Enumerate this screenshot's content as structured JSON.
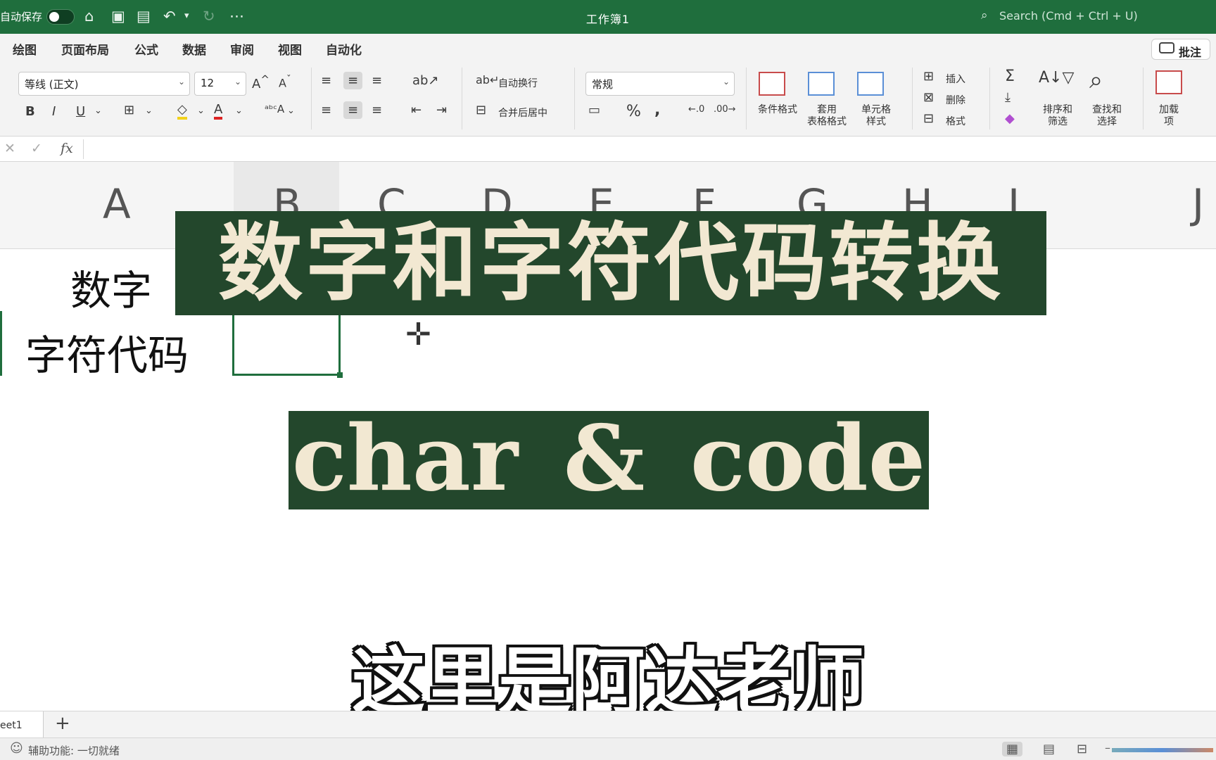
{
  "titlebar": {
    "autosave_label": "自动保存",
    "document_title": "工作簿1",
    "search_placeholder": "Search (Cmd + Ctrl + U)"
  },
  "menu_tabs": [
    "绘图",
    "页面布局",
    "公式",
    "数据",
    "审阅",
    "视图",
    "自动化"
  ],
  "comment_button": "批注",
  "ribbon": {
    "font_name": "等线 (正文)",
    "font_size": "12",
    "wrap_text": "自动换行",
    "merge_center": "合并后居中",
    "number_format": "常规",
    "conditional_format": "条件格式",
    "table_format_1": "套用",
    "table_format_2": "表格格式",
    "cell_style_1": "单元格",
    "cell_style_2": "样式",
    "insert": "插入",
    "delete": "删除",
    "format": "格式",
    "sort_filter_1": "排序和",
    "sort_filter_2": "筛选",
    "find_select_1": "查找和",
    "find_select_2": "选择",
    "addins_1": "加载",
    "addins_2": "项"
  },
  "formula_bar": {
    "fx_label": "fx",
    "value": ""
  },
  "columns": [
    "A",
    "B",
    "C",
    "D",
    "E",
    "F",
    "G",
    "H",
    "I",
    "J"
  ],
  "cells": {
    "a1": "数字",
    "a2": "字符代码"
  },
  "overlay": {
    "title_banner": "数字和字符代码转换",
    "code_banner": "char & code",
    "subtitle": "这里是阿达老师"
  },
  "sheet_tab": "eet1",
  "status_text": "辅助功能: 一切就绪"
}
